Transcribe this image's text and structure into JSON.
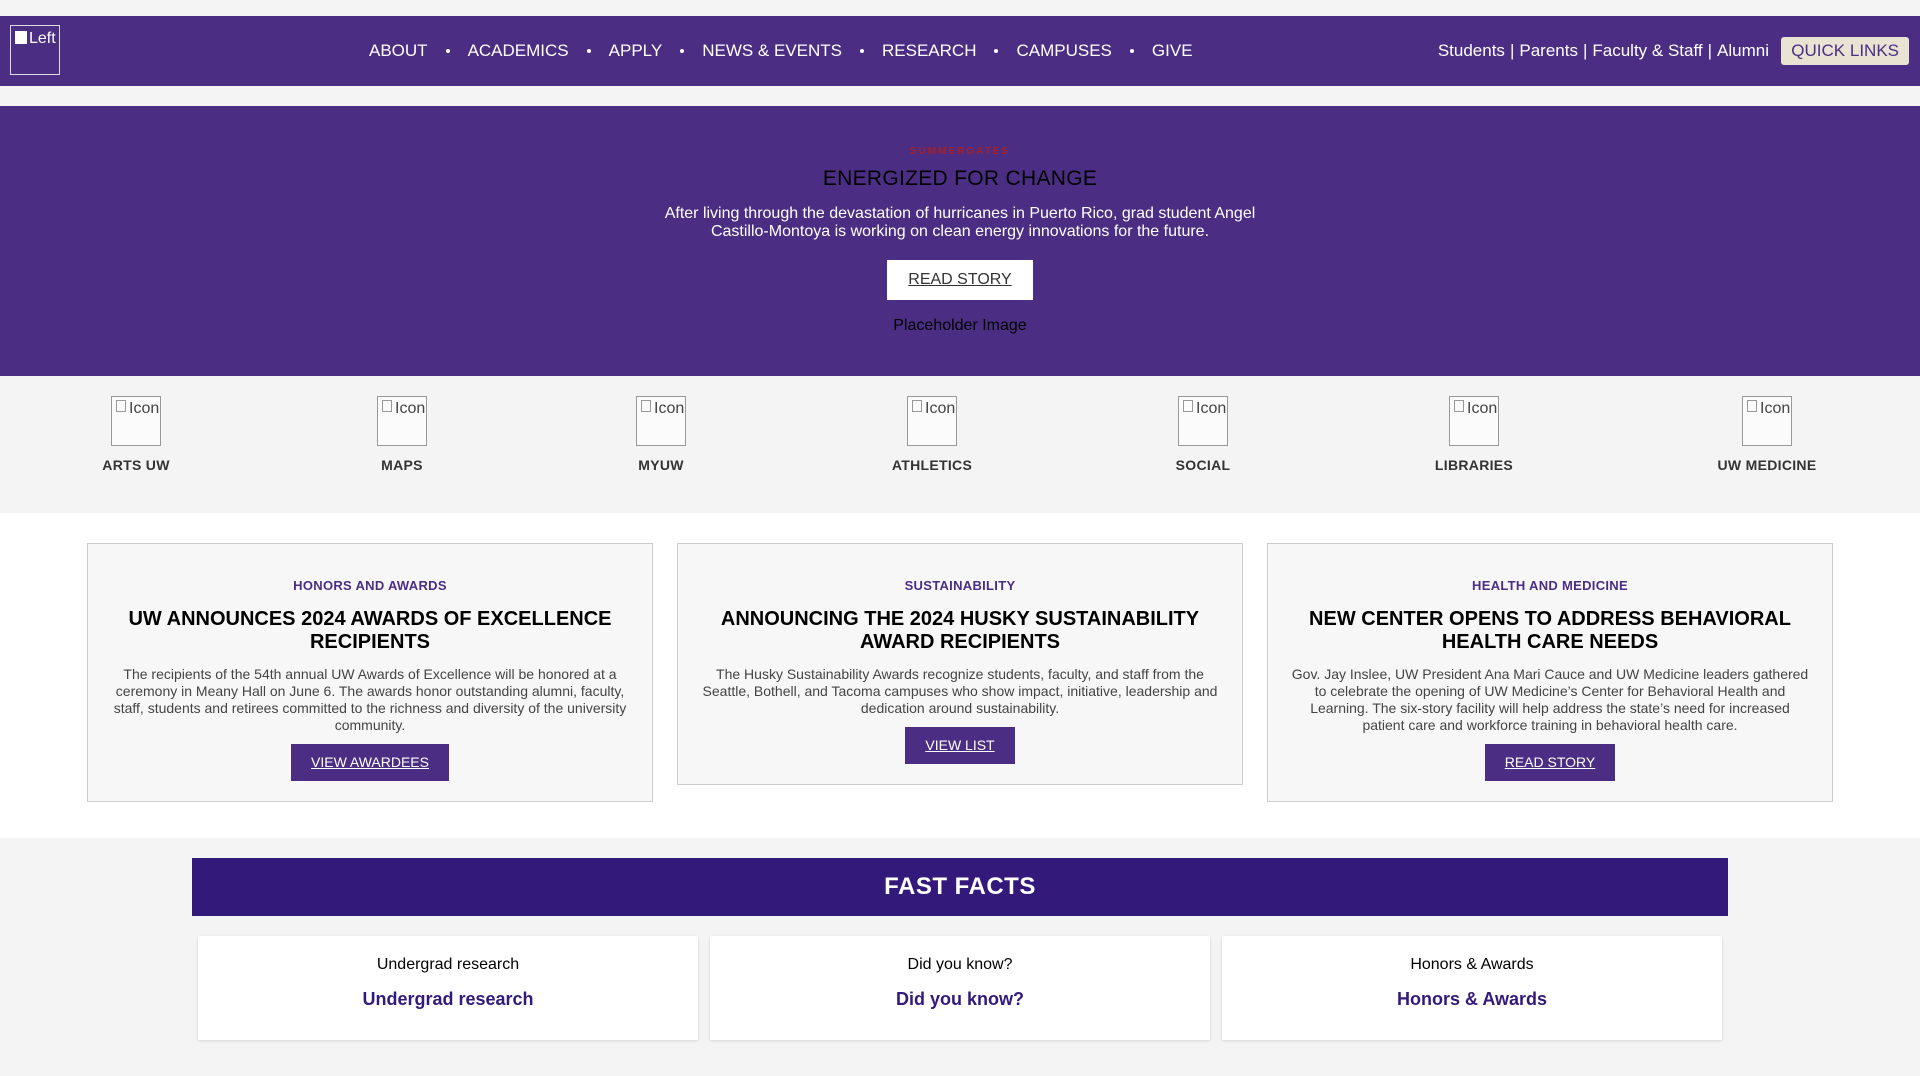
{
  "header": {
    "logo_alt": "Left logo",
    "nav": [
      "ABOUT",
      "ACADEMICS",
      "APPLY",
      "NEWS & EVENTS",
      "RESEARCH",
      "CAMPUSES",
      "GIVE"
    ],
    "audience": [
      "Students",
      "Parents",
      "Faculty & Staff",
      "Alumni"
    ],
    "quick_links": "QUICK LINKS"
  },
  "hero": {
    "kicker": "SUMMERGATES",
    "title": "ENERGIZED FOR CHANGE",
    "text": "After living through the devastation of hurricanes in Puerto Rico, grad student Angel Castillo-Montoya is working on clean energy innovations for the future.",
    "button": "READ STORY",
    "placeholder": "Placeholder Image"
  },
  "icon_links": [
    {
      "label": "ARTS UW",
      "alt": "Icon"
    },
    {
      "label": "MAPS",
      "alt": "Icon"
    },
    {
      "label": "MYUW",
      "alt": "Icon"
    },
    {
      "label": "ATHLETICS",
      "alt": "Icon"
    },
    {
      "label": "SOCIAL",
      "alt": "Icon"
    },
    {
      "label": "LIBRARIES",
      "alt": "Icon"
    },
    {
      "label": "UW MEDICINE",
      "alt": "Icon"
    }
  ],
  "cards": [
    {
      "category": "HONORS AND AWARDS",
      "title": "UW ANNOUNCES 2024 AWARDS OF EXCELLENCE RECIPIENTS",
      "text": "The recipients of the 54th annual UW Awards of Excellence will be honored at a ceremony in Meany Hall on June 6. The awards honor outstanding alumni, faculty, staff, students and retirees committed to the richness and diversity of the university community.",
      "button": "VIEW AWARDEES"
    },
    {
      "category": "SUSTAINABILITY",
      "title": "ANNOUNCING THE 2024 HUSKY SUSTAINABILITY AWARD RECIPIENTS",
      "text": "The Husky Sustainability Awards recognize students, faculty, and staff from the Seattle, Bothell, and Tacoma campuses who show impact, initiative, leadership and dedication around sustainability.",
      "button": "VIEW LIST"
    },
    {
      "category": "HEALTH AND MEDICINE",
      "title": "NEW CENTER OPENS TO ADDRESS BEHAVIORAL HEALTH CARE NEEDS",
      "text": "Gov. Jay Inslee, UW President Ana Mari Cauce and UW Medicine leaders gathered to celebrate the opening of UW Medicine’s Center for Behavioral Health and Learning. The six-story facility will help address the state’s need for increased patient care and workforce training in behavioral health care.",
      "button": "READ STORY"
    }
  ],
  "fast_facts": {
    "heading": "FAST FACTS",
    "items": [
      {
        "small": "Undergrad research",
        "big": "Undergrad research"
      },
      {
        "small": "Did you know?",
        "big": "Did you know?"
      },
      {
        "small": "Honors & Awards",
        "big": "Honors & Awards"
      }
    ]
  },
  "colors": {
    "brand_purple": "#4b2e83",
    "facts_purple": "#32197a",
    "kicker_red": "#a61f27",
    "quick_links_bg": "#e8e3d3"
  }
}
